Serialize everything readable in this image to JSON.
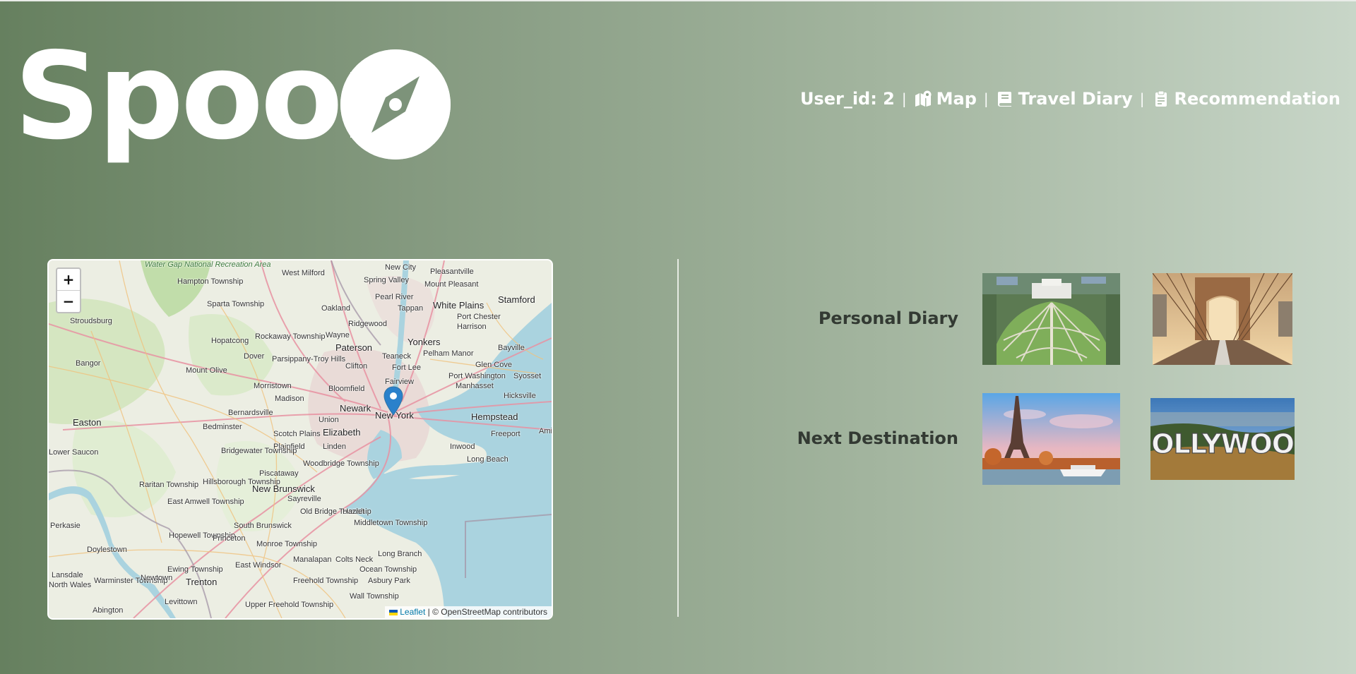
{
  "logo": {
    "text": "Spoor"
  },
  "nav": {
    "user_label": "User_id: 2",
    "separator": "|",
    "items": [
      {
        "label": "Map",
        "icon": "map-location-icon"
      },
      {
        "label": "Travel Diary",
        "icon": "book-icon"
      },
      {
        "label": "Recommendation",
        "icon": "clipboard-icon"
      }
    ]
  },
  "map": {
    "zoom_in": "+",
    "zoom_out": "−",
    "attribution": {
      "leaflet": "Leaflet",
      "rest": " | © OpenStreetMap contributors"
    },
    "labels": [
      "Water Gap National Recreation Area",
      "West Milford",
      "New City",
      "Pleasantville",
      "Hampton Township",
      "Spring Valley",
      "Mount Pleasant",
      "Sparta Township",
      "Oakland",
      "Pearl River",
      "Tappan",
      "White Plains",
      "Stamford",
      "Stroudsburg",
      "Port Chester",
      "Ridgewood",
      "Harrison",
      "Hopatcong",
      "Rockaway Township",
      "Wayne",
      "Paterson",
      "Yonkers",
      "Bayville",
      "Dover",
      "Parsippany-Troy Hills",
      "Teaneck",
      "Pelham Manor",
      "Bangor",
      "Mount Olive",
      "Clifton",
      "Fort Lee",
      "Glen Cove",
      "Port Washington",
      "Syosset",
      "Morristown",
      "Fairview",
      "Bloomfield",
      "Manhasset",
      "Madison",
      "Hicksville",
      "Newark",
      "New York",
      "Hempstead",
      "Bernardsville",
      "Union",
      "Easton",
      "Bedminster",
      "Elizabeth",
      "Freeport",
      "Scotch Plains",
      "Plainfield",
      "Linden",
      "Inwood",
      "Bridgewater Township",
      "Woodbridge Township",
      "Long Beach",
      "Piscataway",
      "Raritan Township",
      "Hillsborough Township",
      "New Brunswick",
      "East Amwell Township",
      "Sayreville",
      "Old Bridge Township",
      "Hazlet",
      "Middletown Township",
      "South Brunswick",
      "Hopewell Township",
      "Princeton",
      "Monroe Township",
      "Perkasie",
      "Doylestown",
      "Long Branch",
      "Ewing Township",
      "Manalapan",
      "Colts Neck",
      "Ocean Township",
      "East Windsor",
      "Lansdale",
      "North Wales",
      "Warminster Township",
      "Newtown",
      "Trenton",
      "Freehold Township",
      "Asbury Park",
      "Wall Township",
      "Levittown",
      "Upper Freehold Township",
      "Abington",
      "Amity",
      "Lower Saucon"
    ]
  },
  "gallery": {
    "rows": [
      {
        "label": "Personal Diary",
        "images": [
          "campus-aerial-image",
          "brooklyn-bridge-image"
        ]
      },
      {
        "label": "Next Destination",
        "images": [
          "eiffel-tower-image",
          "hollywood-sign-image"
        ]
      }
    ],
    "hollywood_text": "HOLLYWOOD"
  },
  "colors": {
    "gradient_start": "#66805f",
    "gradient_end": "#c8d6c8",
    "label_text": "#333a33",
    "marker": "#2a81cb",
    "water": "#aad3df",
    "land": "#eef0e6"
  }
}
